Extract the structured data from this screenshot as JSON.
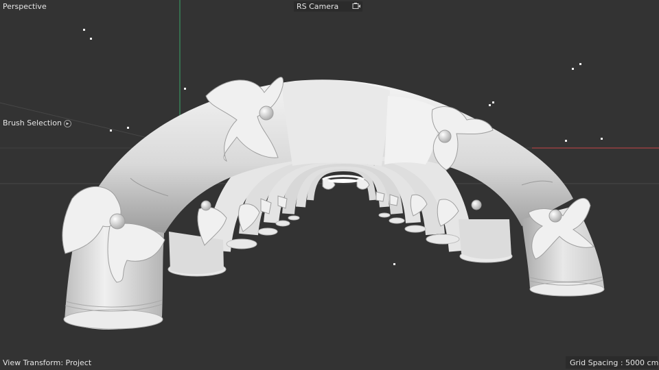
{
  "viewport": {
    "name": "Perspective",
    "camera": "RS Camera",
    "camera_icon": "camera-lock-icon",
    "view_transform": "View Transform: Project",
    "grid_spacing": "Grid Spacing : 5000 cm",
    "background_color": "#333333"
  },
  "tool": {
    "label": "Brush Selection",
    "icon": "radio-dot-icon"
  },
  "colors": {
    "axis_x": "#c8454a",
    "axis_y": "#39a76a",
    "model_fill": "#d7d7d7",
    "model_highlight": "#f4f4f4",
    "model_shadow": "#8e8e8e",
    "hud_text": "#e6e6e6"
  },
  "scene": {
    "model": "white-arched-tunnel-of-tubes-with-ribbon-bows"
  }
}
